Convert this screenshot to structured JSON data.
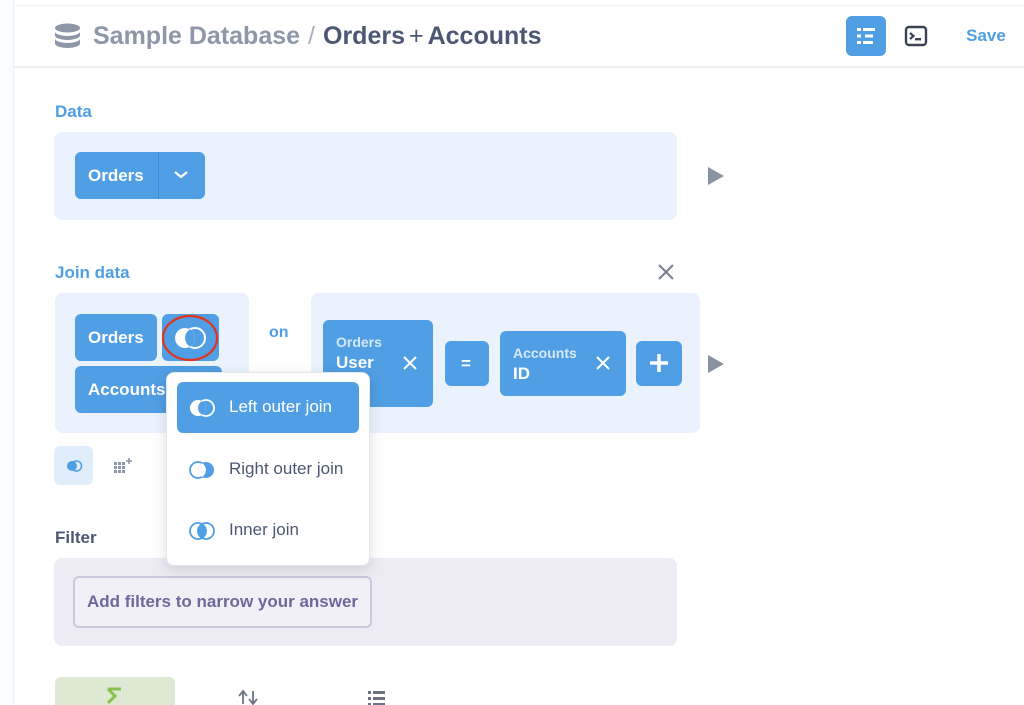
{
  "header": {
    "db_name": "Sample Database",
    "separator": "/",
    "question_table": "Orders",
    "question_plus": "+",
    "question_joined": "Accounts",
    "save_label": "Save"
  },
  "data_section": {
    "label": "Data",
    "table": "Orders"
  },
  "join_section": {
    "label": "Join data",
    "left_table": "Orders",
    "right_table": "Accounts",
    "on_label": "on",
    "left_condition_table": "Orders",
    "left_condition_field": "User",
    "operator": "=",
    "right_condition_table": "Accounts",
    "right_condition_field": "ID"
  },
  "join_type_menu": {
    "options": [
      {
        "label": "Left outer join",
        "selected": true
      },
      {
        "label": "Right outer join",
        "selected": false
      },
      {
        "label": "Inner join",
        "selected": false
      }
    ]
  },
  "filter_section": {
    "label": "Filter",
    "add_filters_label": "Add filters to narrow your answer"
  },
  "icons": {
    "database": "database-icon",
    "notebook": "notebook-icon",
    "sql": "sql-console-icon",
    "join": "left-join-icon",
    "add_grid": "add-column-grid-icon",
    "sum": "sum-icon",
    "sort": "sort-icon",
    "list": "list-icon"
  },
  "colors": {
    "brand": "#509ee3",
    "section_bg": "#eaf3fd",
    "filter_bg": "#edecf4",
    "filter_text": "#6e699b",
    "summarize_bg": "#dde9d3",
    "annotation_red": "#e2331d"
  }
}
